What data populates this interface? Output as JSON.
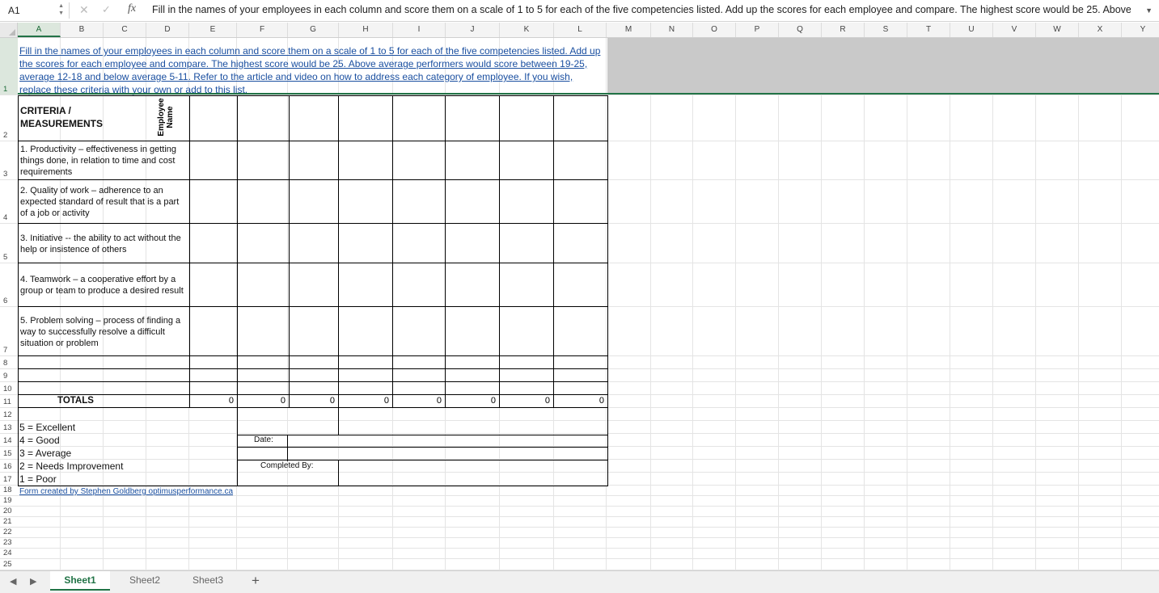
{
  "formula_bar": {
    "name_box": "A1",
    "fx_label": "fx",
    "content": "Fill in the names of your employees in each column and score them on a scale of 1 to 5 for each of the five competencies listed. Add up the scores for each employee and compare. The highest score would be 25. Above"
  },
  "columns": [
    "A",
    "B",
    "C",
    "D",
    "E",
    "F",
    "G",
    "H",
    "I",
    "J",
    "K",
    "L",
    "M",
    "N",
    "O",
    "P",
    "Q",
    "R",
    "S",
    "T",
    "U",
    "V",
    "W",
    "X",
    "Y"
  ],
  "rows": [
    "1",
    "2",
    "3",
    "4",
    "5",
    "6",
    "7",
    "8",
    "9",
    "10",
    "11",
    "12",
    "13",
    "14",
    "15",
    "16",
    "17",
    "18",
    "19",
    "20",
    "21",
    "22",
    "23",
    "24",
    "25"
  ],
  "sheet": {
    "row1_text": "Fill in the names of your employees in each column and score them on a scale of 1 to 5 for each of the five competencies listed. Add up the scores for each employee and compare. The highest score would be 25. Above average performers would score between 19-25, average 12-18 and below average 5-11. Refer to the article and video on how to address each category of employee. If you wish, replace these criteria with your own or add to this list.",
    "criteria_header": "CRITERIA /",
    "criteria_header2": "MEASUREMENTS",
    "employee_name_label": "Employee Name",
    "criteria": [
      "1. Productivity – effectiveness in getting things done, in relation to time and cost requirements",
      "2. Quality of work – adherence to an expected standard of result that is a part of a job or activity",
      "3. Initiative -- the ability to act without the help or insistence of others",
      "4. Teamwork – a cooperative effort by a group or team to produce a desired result",
      "5. Problem solving – process of finding a way to successfully resolve a difficult situation or problem"
    ],
    "totals_label": "TOTALS",
    "totals": [
      "0",
      "0",
      "0",
      "0",
      "0",
      "0",
      "0",
      "0"
    ],
    "legend": [
      "5 = Excellent",
      "4 = Good",
      "3 = Average",
      "2 = Needs Improvement",
      "1 = Poor"
    ],
    "date_label": "Date:",
    "completed_by_label": "Completed By:",
    "credit_link": "Form created by Stephen Goldberg optimusperformance.ca"
  },
  "tabs": {
    "sheets": [
      "Sheet1",
      "Sheet2",
      "Sheet3"
    ],
    "active": "Sheet1",
    "add": "+"
  }
}
